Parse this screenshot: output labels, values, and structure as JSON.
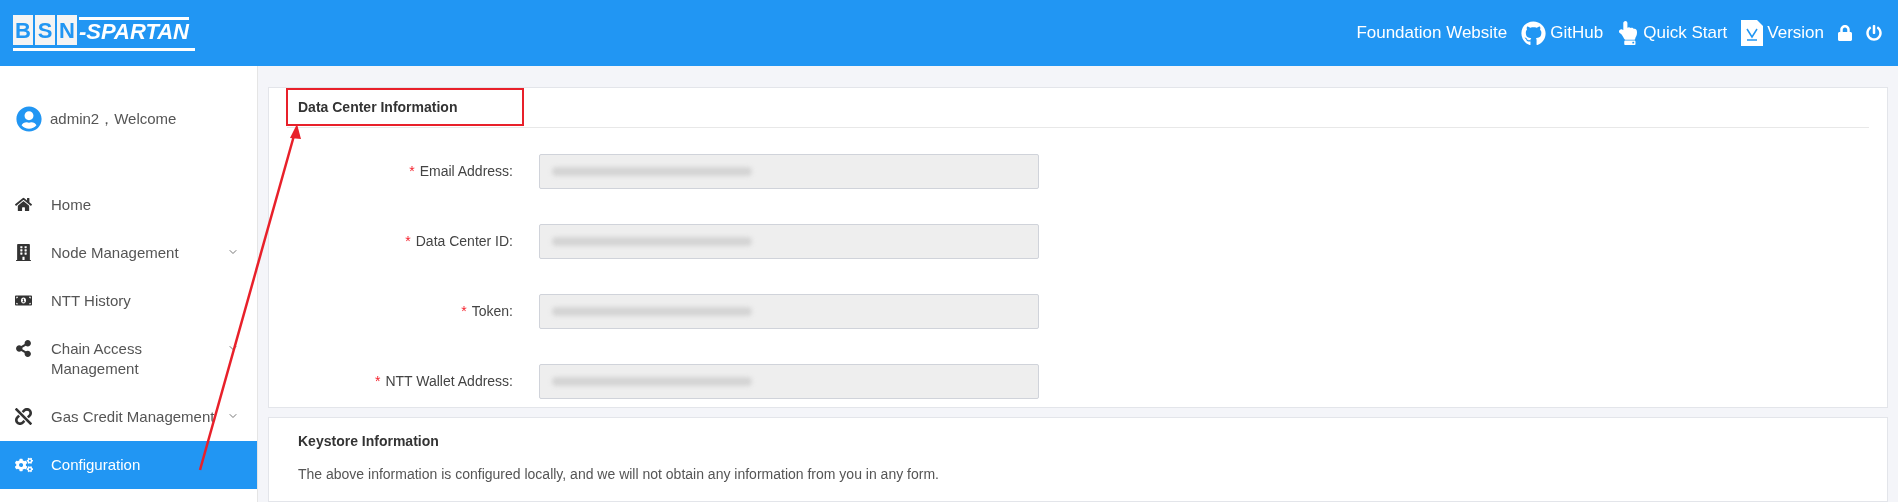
{
  "header": {
    "logo_letters": [
      "B",
      "S",
      "N"
    ],
    "logo_rest": "-SPARTAN",
    "links": [
      {
        "kind": "text",
        "label": "Foundation Website"
      },
      {
        "kind": "github",
        "label": "GitHub"
      },
      {
        "kind": "touch",
        "label": "Quick Start"
      },
      {
        "kind": "version",
        "label": "Version"
      },
      {
        "kind": "lock"
      },
      {
        "kind": "power"
      }
    ]
  },
  "user": {
    "greeting": "admin2，Welcome"
  },
  "sidebar": {
    "items": [
      {
        "kind": "home",
        "label": "Home",
        "expandable": false,
        "selected": false
      },
      {
        "kind": "building",
        "label": "Node Management",
        "expandable": true,
        "selected": false
      },
      {
        "kind": "money",
        "label": "NTT History",
        "expandable": false,
        "selected": false
      },
      {
        "kind": "share",
        "label": "Chain Access Management",
        "expandable": true,
        "selected": false
      },
      {
        "kind": "link",
        "label": "Gas Credit Management",
        "expandable": true,
        "selected": false
      },
      {
        "kind": "gears",
        "label": "Configuration",
        "expandable": false,
        "selected": true
      }
    ]
  },
  "data_center": {
    "title": "Data Center Information",
    "fields": [
      {
        "mark": "*",
        "label": "Email Address:"
      },
      {
        "mark": "*",
        "label": "Data Center ID:"
      },
      {
        "mark": "*",
        "label": "Token:"
      },
      {
        "mark": "*",
        "label": "NTT Wallet Address:"
      }
    ]
  },
  "keystore": {
    "title": "Keystore Information",
    "note": "The above information is configured locally, and we will not obtain any information from you in any form."
  }
}
